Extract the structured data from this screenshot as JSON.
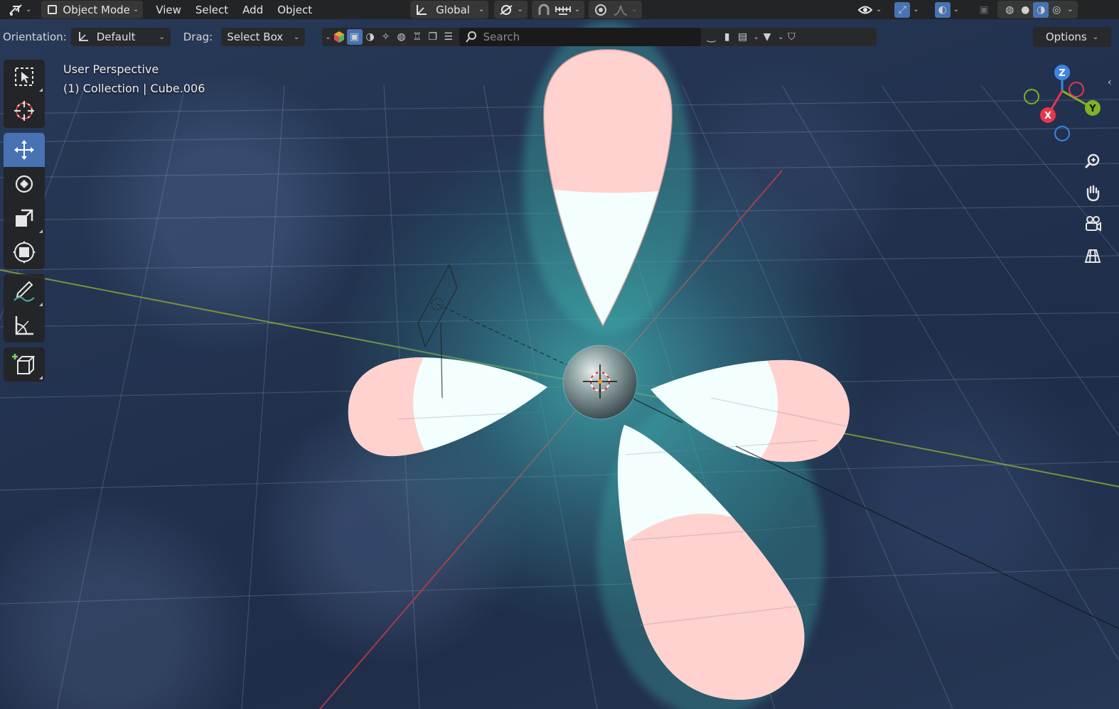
{
  "header": {
    "mode_label": "Object Mode",
    "menus": [
      "View",
      "Select",
      "Add",
      "Object"
    ],
    "transform_orientation": "Global"
  },
  "tool_settings": {
    "orientation_label": "Orientation:",
    "orientation_value": "Default",
    "drag_label": "Drag:",
    "drag_value": "Select Box",
    "search_placeholder": "Search",
    "options_label": "Options"
  },
  "viewport": {
    "view_name": "User Perspective",
    "collection_info": "(1) Collection | Cube.006"
  },
  "gizmo": {
    "z_label": "Z",
    "y_label": "Y",
    "x_label": "X",
    "x_color": "#e5384c",
    "y_color": "#7fb327",
    "z_color": "#3d86e0"
  },
  "tools": [
    {
      "name": "select-box-tool",
      "icon": "select-box-icon"
    },
    {
      "name": "cursor-tool",
      "icon": "cursor-icon"
    },
    {
      "name": "move-tool",
      "icon": "move-icon",
      "active": true
    },
    {
      "name": "rotate-tool",
      "icon": "rotate-icon"
    },
    {
      "name": "scale-tool",
      "icon": "scale-icon"
    },
    {
      "name": "transform-tool",
      "icon": "transform-icon"
    },
    {
      "name": "annotate-tool",
      "icon": "annotate-icon"
    },
    {
      "name": "measure-tool",
      "icon": "measure-icon"
    },
    {
      "name": "add-cube-tool",
      "icon": "add-cube-icon"
    }
  ],
  "colors": {
    "accent": "#4772b3",
    "lobe_pink": "#ffd1cf",
    "lobe_white": "#f2fffe",
    "glow_teal": "#3fb9b3"
  }
}
